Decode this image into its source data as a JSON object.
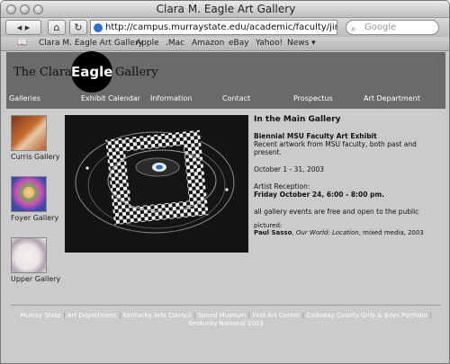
{
  "window": {
    "title": "Clara M. Eagle Art Gallery"
  },
  "toolbar": {
    "url": "http://campus.murraystate.edu/academic/faculty/jim.bryant/eag",
    "search_placeholder": "Google"
  },
  "bookmarks": [
    "Clara M. Eagle Art Gallery",
    "Apple",
    ".Mac",
    "Amazon",
    "eBay",
    "Yahoo!",
    "News ▾"
  ],
  "site": {
    "logo_left": "The Clara M",
    "logo_center": "Eagle",
    "logo_right": "Gallery",
    "nav": [
      "Galleries",
      "Exhibit Calendar",
      "Information",
      "Contact",
      "Prospectus",
      "Art Department"
    ],
    "sidebar": [
      {
        "label": "Curris Gallery"
      },
      {
        "label": "Foyer Gallery"
      },
      {
        "label": "Upper Gallery"
      }
    ],
    "main": {
      "heading": "In the Main Gallery",
      "exhibit_title": "Biennial MSU Faculty Art Exhibit",
      "exhibit_desc": "Recent artwork from MSU faculty, both past and present.",
      "dates": "October 1 - 31, 2003",
      "reception_label": "Artist Reception:",
      "reception_time": "Friday October 24, 6:00 - 8:00 pm.",
      "note": "all gallery events are free and open to the public",
      "pictured_label": "pictured:",
      "pictured_artist": "Paul Sasso",
      "pictured_work": "Our World: Location",
      "pictured_info": ", mixed media, 2003"
    },
    "footer_links": [
      "Murray State",
      "Art Department",
      "Kentucky Arts Council",
      "Speed Museum",
      "First Art Center",
      "Calloway County Girls & Boys Portfolio",
      "Kentucky National 2003"
    ]
  }
}
